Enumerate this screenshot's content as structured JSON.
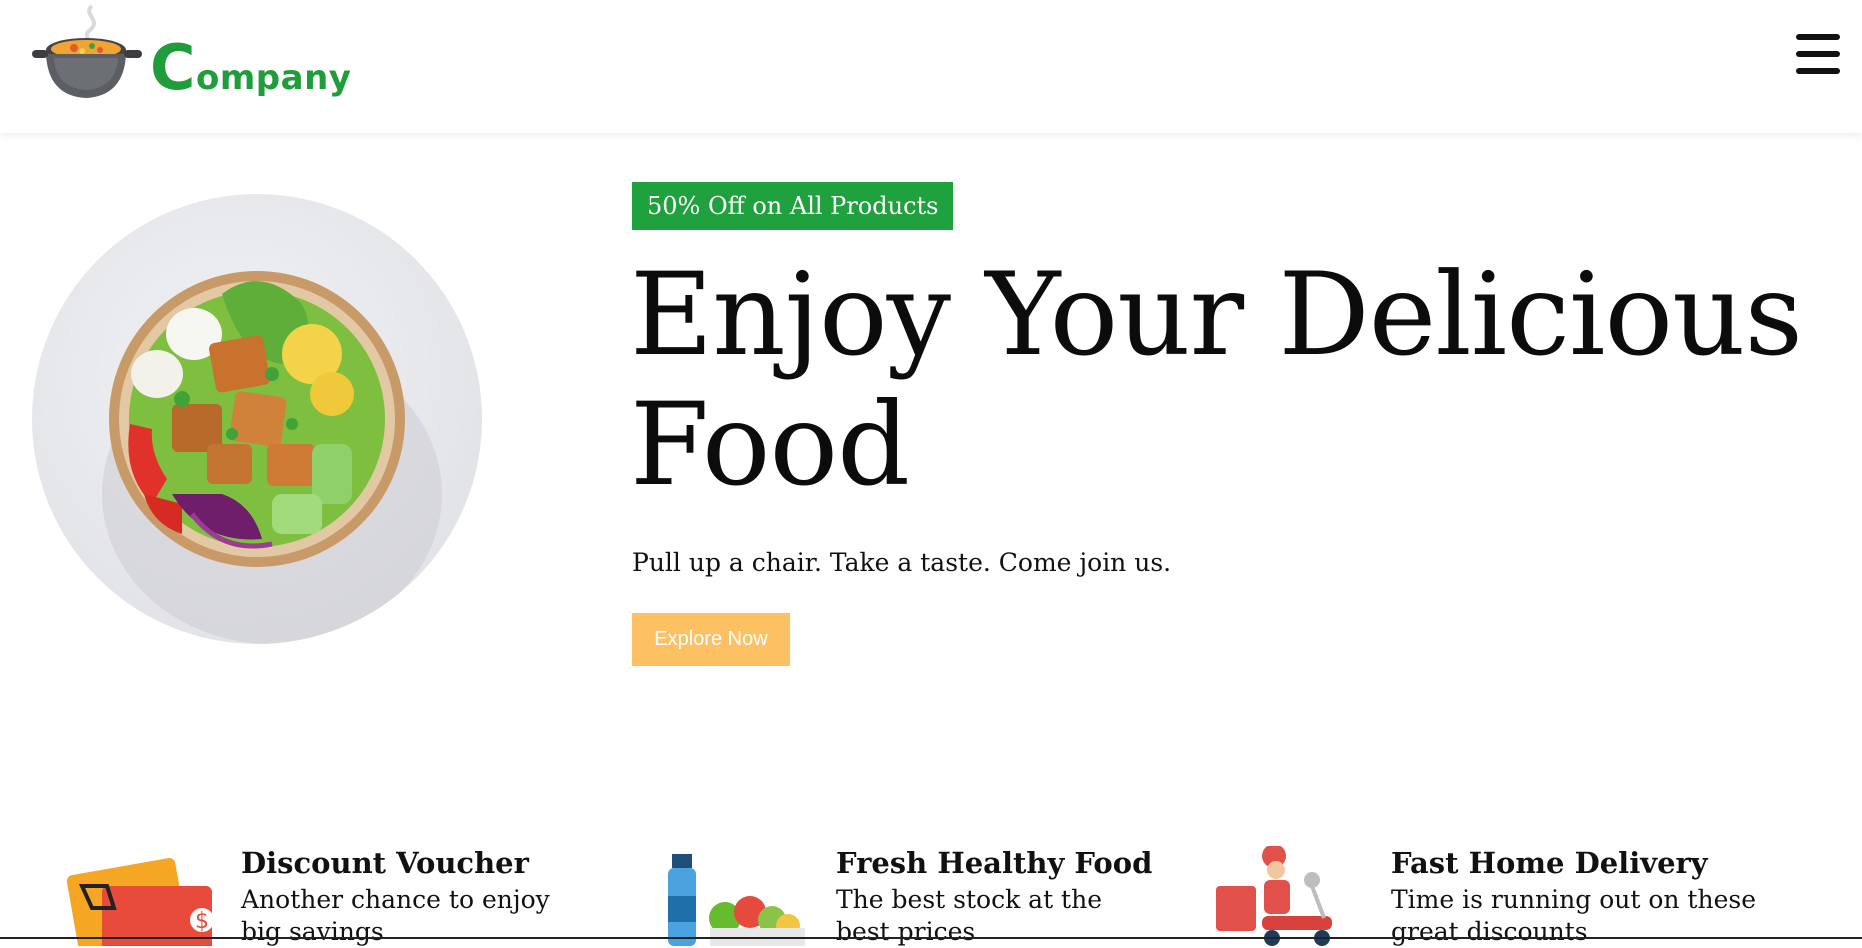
{
  "header": {
    "logo_text_first": "C",
    "logo_text_rest": "ompany",
    "logo_icon": "soup-pot-icon",
    "menu_icon": "hamburger-menu-icon"
  },
  "hero": {
    "badge": "50% Off on All Products",
    "title": "Enjoy Your Delicious Food",
    "subtitle": "Pull up a chair. Take a taste. Come join us.",
    "cta_label": "Explore Now",
    "image": "salad-bowl-image"
  },
  "features": [
    {
      "icon": "discount-voucher-icon",
      "title": "Discount Voucher",
      "desc": "Another chance to enjoy big savings"
    },
    {
      "icon": "healthy-food-icon",
      "title": "Fresh Healthy Food",
      "desc": "The best stock at the best prices"
    },
    {
      "icon": "delivery-scooter-icon",
      "title": "Fast Home Delivery",
      "desc": "Time is running out on these great discounts"
    }
  ],
  "colors": {
    "brand_green": "#1fa13d",
    "cta_orange": "#fdc062",
    "text": "#111111"
  }
}
